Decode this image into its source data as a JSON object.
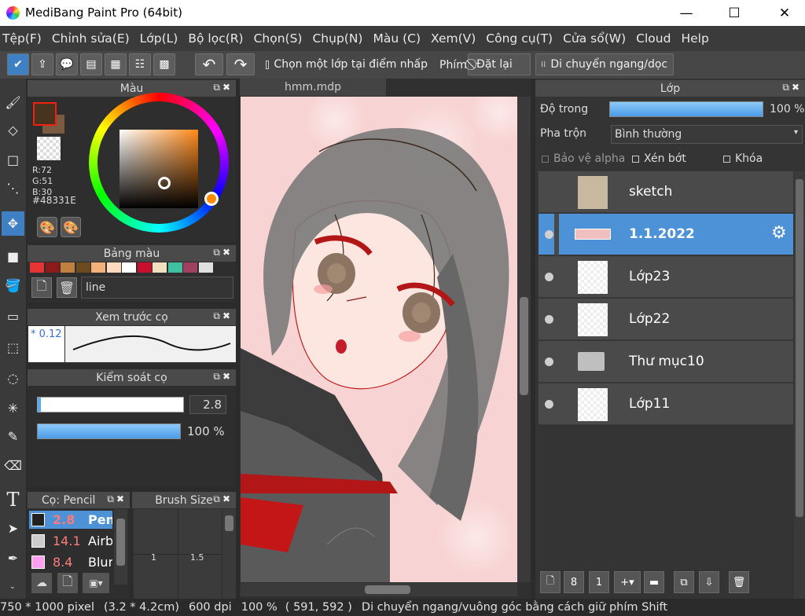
{
  "window": {
    "title": "MediBang Paint Pro (64bit)",
    "minimize": "—",
    "maximize": "☐",
    "close": "✕"
  },
  "menu": [
    "Tệp(F)",
    "Chỉnh sửa(E)",
    "Lớp(L)",
    "Bộ lọc(R)",
    "Chọn(S)",
    "Chụp(N)",
    "Màu (C)",
    "Xem(V)",
    "Công cụ(T)",
    "Cửa sổ(W)",
    "Cloud",
    "Help"
  ],
  "toolbar": {
    "select_layer_label": "Chọn một lớp tại điểm nhấp",
    "key_label": "Phím",
    "reset_label": "Đặt lại",
    "move_label": "Di chuyển ngang/dọc"
  },
  "color_panel": {
    "title": "Màu",
    "r": "R:72",
    "g": "G:51",
    "b": "B:30",
    "hex": "#48331E",
    "main_color": "#48331e"
  },
  "palette_panel": {
    "title": "Bảng màu",
    "item": "line",
    "colors": [
      "#e63333",
      "#8b1a1a",
      "#c08040",
      "#6b4a20",
      "#f2b07a",
      "#ffd9c0",
      "#ffffff",
      "#c8102e",
      "#f0e0c0",
      "#40c0a0",
      "#a04060",
      "#e0e0e0"
    ]
  },
  "brush_preview": {
    "title": "Xem trước cọ",
    "size": "* 0.12"
  },
  "brush_control": {
    "title": "Kiểm soát cọ",
    "size_value": "2.8",
    "opacity_value": "100 %",
    "size_fraction": 0.02,
    "opacity_fraction": 1.0
  },
  "brush_list": {
    "title": "Cọ: Pencil",
    "items": [
      {
        "size": "2.8",
        "name": "Pen",
        "color": "#222222"
      },
      {
        "size": "14.1",
        "name": "Airb",
        "color": "#cccccc"
      },
      {
        "size": "8.4",
        "name": "Blur",
        "color": "#ff9ff0"
      }
    ]
  },
  "brush_size": {
    "title": "Brush Size",
    "values": [
      "1",
      "1.5"
    ]
  },
  "canvas": {
    "tab": "hmm.mdp"
  },
  "layers_panel": {
    "title": "Lớp",
    "opacity_label": "Độ trong",
    "opacity_value": "100 %",
    "opacity_fraction": 1.0,
    "blend_label": "Pha trộn",
    "blend_value": "Bình thường",
    "protect_alpha": "Bảo vệ alpha",
    "clipping": "Xén bớt",
    "lock": "Khóa",
    "layers": [
      {
        "name": "sketch"
      },
      {
        "name": "1.1.2022"
      },
      {
        "name": "Lớp23"
      },
      {
        "name": "Lớp22"
      },
      {
        "name": "Thư mục10"
      },
      {
        "name": "Lớp11"
      }
    ]
  },
  "status": {
    "size": "750 * 1000 pixel",
    "cm": "(3.2 * 4.2cm)",
    "dpi": "600 dpi",
    "zoom": "100 %",
    "coords": "( 591, 592 )",
    "hint": "Di chuyển ngang/vuông góc bằng cách giữ phím Shift"
  }
}
